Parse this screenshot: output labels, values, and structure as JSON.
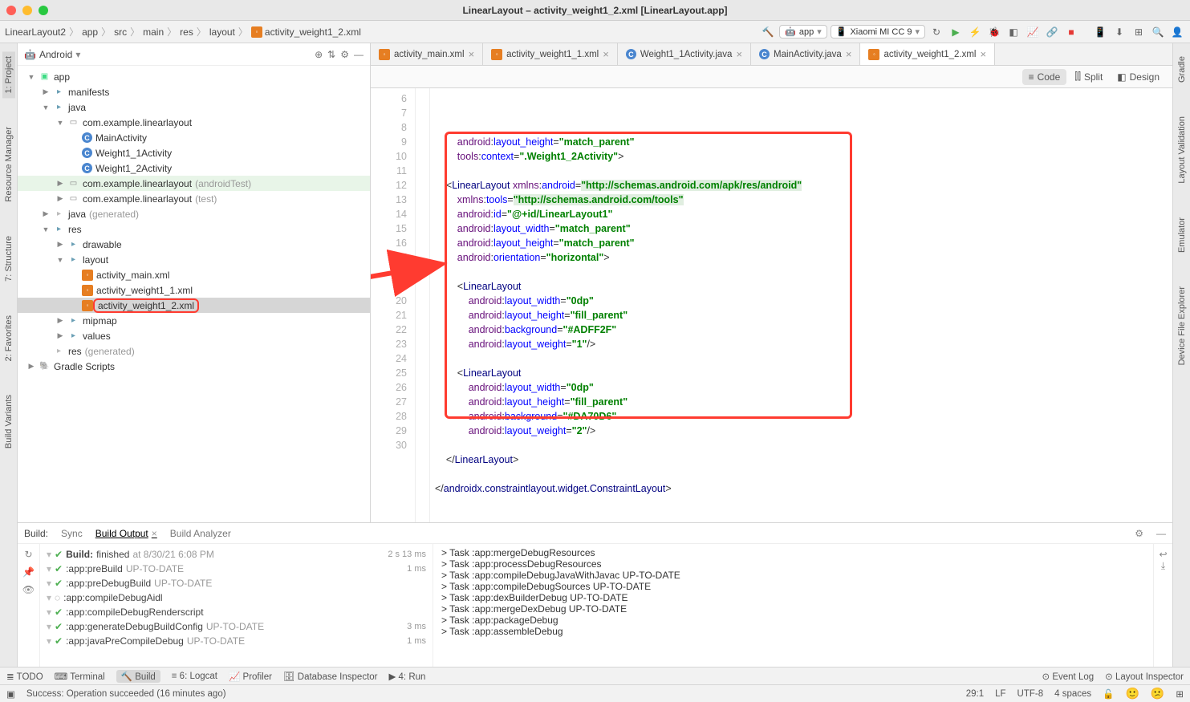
{
  "window": {
    "title": "LinearLayout – activity_weight1_2.xml [LinearLayout.app]"
  },
  "breadcrumb": [
    "LinearLayout2",
    "app",
    "src",
    "main",
    "res",
    "layout",
    "activity_weight1_2.xml"
  ],
  "run_config": "app",
  "device": "Xiaomi MI CC 9",
  "gutter_left": [
    "1: Project",
    "Resource Manager",
    "7: Structure",
    "2: Favorites",
    "Build Variants"
  ],
  "gutter_right": [
    "Gradle",
    "Layout Validation",
    "Emulator",
    "Device File Explorer"
  ],
  "project": {
    "mode": "Android",
    "rows": [
      {
        "d": 0,
        "exp": "▼",
        "icon": "app",
        "label": "app"
      },
      {
        "d": 1,
        "exp": "▶",
        "icon": "folder",
        "label": "manifests"
      },
      {
        "d": 1,
        "exp": "▼",
        "icon": "folder",
        "label": "java"
      },
      {
        "d": 2,
        "exp": "▼",
        "icon": "package",
        "label": "com.example.linearlayout"
      },
      {
        "d": 3,
        "exp": "",
        "icon": "class",
        "label": "MainActivity"
      },
      {
        "d": 3,
        "exp": "",
        "icon": "class",
        "label": "Weight1_1Activity"
      },
      {
        "d": 3,
        "exp": "",
        "icon": "class",
        "label": "Weight1_2Activity"
      },
      {
        "d": 2,
        "exp": "▶",
        "icon": "package",
        "label": "com.example.linearlayout",
        "suffix": "(androidTest)",
        "hl": true
      },
      {
        "d": 2,
        "exp": "▶",
        "icon": "package",
        "label": "com.example.linearlayout",
        "suffix": "(test)"
      },
      {
        "d": 1,
        "exp": "▶",
        "icon": "folder-grey",
        "label": "java",
        "suffix": "(generated)"
      },
      {
        "d": 1,
        "exp": "▼",
        "icon": "folder",
        "label": "res"
      },
      {
        "d": 2,
        "exp": "▶",
        "icon": "folder",
        "label": "drawable"
      },
      {
        "d": 2,
        "exp": "▼",
        "icon": "folder",
        "label": "layout"
      },
      {
        "d": 3,
        "exp": "",
        "icon": "xml",
        "label": "activity_main.xml"
      },
      {
        "d": 3,
        "exp": "",
        "icon": "xml",
        "label": "activity_weight1_1.xml"
      },
      {
        "d": 3,
        "exp": "",
        "icon": "xml",
        "label": "activity_weight1_2.xml",
        "selected": true,
        "boxed": true
      },
      {
        "d": 2,
        "exp": "▶",
        "icon": "folder",
        "label": "mipmap"
      },
      {
        "d": 2,
        "exp": "▶",
        "icon": "folder",
        "label": "values"
      },
      {
        "d": 1,
        "exp": "",
        "icon": "folder-grey",
        "label": "res",
        "suffix": "(generated)"
      },
      {
        "d": 0,
        "exp": "▶",
        "icon": "gradle",
        "label": "Gradle Scripts"
      }
    ]
  },
  "tabs": [
    {
      "icon": "xml",
      "label": "activity_main.xml"
    },
    {
      "icon": "xml",
      "label": "activity_weight1_1.xml"
    },
    {
      "icon": "class",
      "label": "Weight1_1Activity.java"
    },
    {
      "icon": "class",
      "label": "MainActivity.java"
    },
    {
      "icon": "xml",
      "label": "activity_weight1_2.xml",
      "active": true
    }
  ],
  "view_switcher": {
    "code": "Code",
    "split": "Split",
    "design": "Design"
  },
  "line_numbers": [
    6,
    7,
    8,
    9,
    10,
    11,
    12,
    13,
    14,
    15,
    16,
    17,
    18,
    19,
    20,
    21,
    22,
    23,
    24,
    25,
    26,
    27,
    28,
    29,
    30
  ],
  "code_lines": [
    {
      "html": "        <span class='ns'>android</span>:<span class='attr'>layout_height</span>=<span class='str'>\"match_parent\"</span>"
    },
    {
      "html": "        <span class='ns'>tools</span>:<span class='attr'>context</span>=<span class='str'>\".Weight1_2Activity\"</span>&gt;"
    },
    {
      "html": ""
    },
    {
      "html": "    &lt;<span class='tag'>LinearLayout</span> <span class='ns'>xmlns</span>:<span class='attr'>android</span>=<span class='url'>\"http://schemas.android.com/apk/res/android\"</span>"
    },
    {
      "html": "        <span class='ns'>xmlns</span>:<span class='attr'>tools</span>=<span class='url'>\"http://schemas.android.com/tools\"</span>"
    },
    {
      "html": "        <span class='ns'>android</span>:<span class='attr'>id</span>=<span class='str'>\"@+id/LinearLayout1\"</span>"
    },
    {
      "html": "        <span class='ns'>android</span>:<span class='attr'>layout_width</span>=<span class='str'>\"match_parent\"</span>"
    },
    {
      "html": "        <span class='ns'>android</span>:<span class='attr'>layout_height</span>=<span class='str'>\"match_parent\"</span>"
    },
    {
      "html": "        <span class='ns'>android</span>:<span class='attr'>orientation</span>=<span class='str'>\"horizontal\"</span>&gt;"
    },
    {
      "html": ""
    },
    {
      "html": "        &lt;<span class='tag'>LinearLayout</span>"
    },
    {
      "html": "            <span class='ns'>android</span>:<span class='attr'>layout_width</span>=<span class='str'>\"0dp\"</span>"
    },
    {
      "html": "            <span class='ns'>android</span>:<span class='attr'>layout_height</span>=<span class='str'>\"fill_parent\"</span>"
    },
    {
      "html": "            <span class='ns'>android</span>:<span class='attr'>background</span>=<span class='str'>\"#ADFF2F\"</span>"
    },
    {
      "html": "            <span class='ns'>android</span>:<span class='attr'>layout_weight</span>=<span class='str'>\"1\"</span>/&gt;"
    },
    {
      "html": ""
    },
    {
      "html": "        &lt;<span class='tag'>LinearLayout</span>"
    },
    {
      "html": "            <span class='ns'>android</span>:<span class='attr'>layout_width</span>=<span class='str'>\"0dp\"</span>"
    },
    {
      "html": "            <span class='ns'>android</span>:<span class='attr'>layout_height</span>=<span class='str'>\"fill_parent\"</span>"
    },
    {
      "html": "            <span class='ns'>android</span>:<span class='attr'>background</span>=<span class='str'>\"#DA70D6\"</span>"
    },
    {
      "html": "            <span class='ns'>android</span>:<span class='attr'>layout_weight</span>=<span class='str'>\"2\"</span>/&gt;"
    },
    {
      "html": ""
    },
    {
      "html": "    &lt;/<span class='tag'>LinearLayout</span>&gt;"
    },
    {
      "html": ""
    },
    {
      "html": "&lt;/<span class='tag'>androidx.constraintlayout.widget.ConstraintLayout</span>&gt;"
    }
  ],
  "editor_breadcrumb": "androidx.constraintlayout.widget.ConstraintLayout",
  "build": {
    "label_build": "Build:",
    "tabs": [
      "Sync",
      "Build Output",
      "Build Analyzer"
    ],
    "tree": [
      {
        "icon": "tick",
        "bold": "Build:",
        "label": " finished",
        "grey": " at 8/30/21 6:08 PM",
        "time": "2 s 13 ms"
      },
      {
        "icon": "tick",
        "label": ":app:preBuild",
        "grey": " UP-TO-DATE",
        "time": "1 ms"
      },
      {
        "icon": "tick",
        "label": ":app:preDebugBuild",
        "grey": " UP-TO-DATE",
        "time": ""
      },
      {
        "icon": "spin",
        "label": ":app:compileDebugAidl",
        "time": ""
      },
      {
        "icon": "tick",
        "label": ":app:compileDebugRenderscript",
        "time": ""
      },
      {
        "icon": "tick",
        "label": ":app:generateDebugBuildConfig",
        "grey": " UP-TO-DATE",
        "time": "3 ms"
      },
      {
        "icon": "tick",
        "label": ":app:javaPreCompileDebug",
        "grey": " UP-TO-DATE",
        "time": "1 ms"
      }
    ],
    "log": [
      "> Task :app:mergeDebugResources",
      "> Task :app:processDebugResources",
      "> Task :app:compileDebugJavaWithJavac UP-TO-DATE",
      "> Task :app:compileDebugSources UP-TO-DATE",
      "> Task :app:dexBuilderDebug UP-TO-DATE",
      "> Task :app:mergeDexDebug UP-TO-DATE",
      "> Task :app:packageDebug",
      "> Task :app:assembleDebug"
    ]
  },
  "bottom_tools": {
    "items": [
      "TODO",
      "Terminal",
      "Build",
      "6: Logcat",
      "Profiler",
      "Database Inspector",
      "4: Run"
    ],
    "active": "Build",
    "right": [
      "Event Log",
      "Layout Inspector"
    ]
  },
  "status": {
    "msg": "Success: Operation succeeded (16 minutes ago)",
    "cursor": "29:1",
    "lf": "LF",
    "enc": "UTF-8",
    "indent": "4 spaces"
  }
}
